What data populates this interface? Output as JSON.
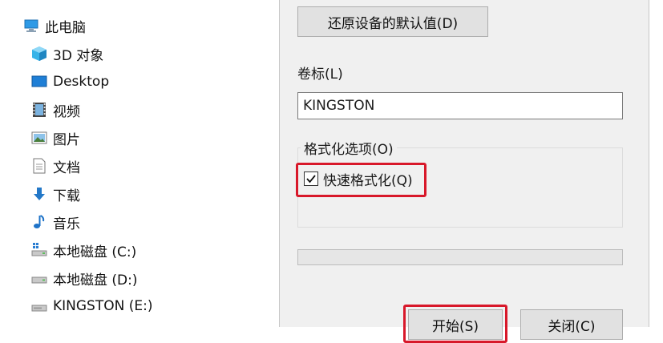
{
  "sidebar": {
    "items": [
      {
        "label": "此电脑",
        "icon": "this-pc-icon"
      },
      {
        "label": "3D 对象",
        "icon": "3d-objects-icon"
      },
      {
        "label": "Desktop",
        "icon": "desktop-icon"
      },
      {
        "label": "视频",
        "icon": "videos-icon"
      },
      {
        "label": "图片",
        "icon": "pictures-icon"
      },
      {
        "label": "文档",
        "icon": "documents-icon"
      },
      {
        "label": "下载",
        "icon": "downloads-icon"
      },
      {
        "label": "音乐",
        "icon": "music-icon"
      },
      {
        "label": "本地磁盘 (C:)",
        "icon": "drive-c-icon"
      },
      {
        "label": "本地磁盘 (D:)",
        "icon": "drive-d-icon"
      },
      {
        "label": "KINGSTON (E:)",
        "icon": "usb-drive-icon"
      }
    ]
  },
  "dialog": {
    "restore_defaults_label": "还原设备的默认值(D)",
    "volume_label_caption": "卷标(L)",
    "volume_label_value": "KINGSTON",
    "format_options_title": "格式化选项(O)",
    "quick_format_label": "快速格式化(Q)",
    "quick_format_checked": true,
    "progress_fraction": 0,
    "start_label": "开始(S)",
    "close_label": "关闭(C)"
  },
  "colors": {
    "highlight": "#d8182a",
    "dialog_bg": "#f0f0f0",
    "button_bg": "#e1e1e1"
  }
}
